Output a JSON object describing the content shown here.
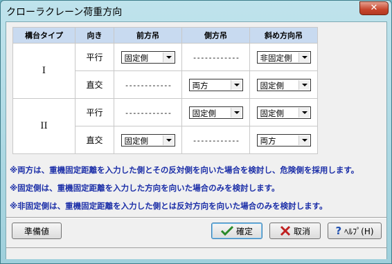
{
  "window": {
    "title": "クローラクレーン荷重方向"
  },
  "table": {
    "headers": [
      "構台タイプ",
      "向き",
      "前方吊",
      "側方吊",
      "斜め方向吊"
    ],
    "rows": [
      {
        "type": "I",
        "dir": "平行",
        "front": "固定側",
        "side": "------------",
        "diag": "非固定側"
      },
      {
        "type": "",
        "dir": "直交",
        "front": "------------",
        "side": "両方",
        "diag": "固定側"
      },
      {
        "type": "II",
        "dir": "平行",
        "front": "------------",
        "side": "固定側",
        "diag": "固定側"
      },
      {
        "type": "",
        "dir": "直交",
        "front": "固定側",
        "side": "------------",
        "diag": "両方"
      }
    ]
  },
  "notes": [
    "※両方は、重機固定距離を入力した側とその反対側を向いた場合を検討し、危険側を採用します。",
    "※固定側は、重機固定距離を入力した方向を向いた場合のみを検討します。",
    "※非固定側は、重機固定距離を入力した側とは反対方向を向いた場合のみを検討します。"
  ],
  "buttons": {
    "standard": "準備値",
    "ok": "確定",
    "cancel": "取消",
    "help": "ﾍﾙﾌﾟ(H)"
  },
  "icons": [
    "close-icon",
    "checkmark-icon",
    "cancel-x-icon",
    "help-question-icon",
    "dropdown-arrow-icon"
  ]
}
